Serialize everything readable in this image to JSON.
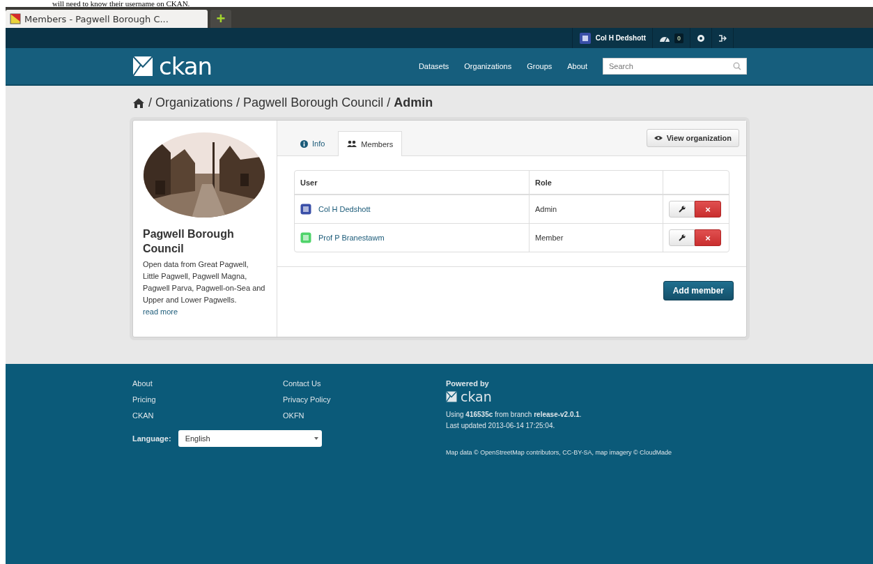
{
  "document_caption": "will need to know their username on CKAN.",
  "browser": {
    "tab_title": "Members - Pagwell Borough C...",
    "new_tab": "+"
  },
  "account_bar": {
    "user": "Col H Dedshott",
    "color": "#3a4fa8",
    "dashboard_count": "0"
  },
  "masthead": {
    "logo": "ckan",
    "nav": [
      {
        "label": "Datasets"
      },
      {
        "label": "Organizations"
      },
      {
        "label": "Groups"
      },
      {
        "label": "About"
      }
    ],
    "search": {
      "placeholder": "Search"
    }
  },
  "breadcrumb": {
    "separator": "/",
    "items": [
      {
        "label": "Organizations",
        "current": false
      },
      {
        "label": "Pagwell Borough Council",
        "current": false
      },
      {
        "label": "Admin",
        "current": true
      }
    ]
  },
  "organization": {
    "name": "Pagwell Borough Council",
    "description": "Open data from Great Pagwell, Little Pagwell, Pagwell Magna, Pagwell Parva, Pagwell-on-Sea and Upper and Lower Pagwells.",
    "read_more": "read more"
  },
  "tabs": [
    {
      "label": "Info",
      "kind": "info",
      "selected": false
    },
    {
      "label": "Members",
      "kind": "users",
      "selected": true
    }
  ],
  "view_button": "View organization",
  "table": {
    "columns": [
      "User",
      "Role"
    ],
    "rows": [
      {
        "user": "Col H Dedshott",
        "color": "#3a4fa8",
        "role": "Admin",
        "delete": "×"
      },
      {
        "user": "Prof P Branestawm",
        "color": "#4fd36a",
        "role": "Member",
        "delete": "×"
      }
    ]
  },
  "add_button": "Add member",
  "footer": {
    "links_1": [
      "About",
      "Pricing",
      "CKAN"
    ],
    "links_2": [
      "Contact Us",
      "Privacy Policy",
      "OKFN"
    ],
    "language": {
      "label": "Language:",
      "value": "English"
    },
    "powered_by": "Powered by",
    "logo": "ckan",
    "version": "Using **416535c** from branch **release-v2.0.1**.",
    "updated": "Last updated 2013-06-14 17:25:04.",
    "map_credit": "Map data © OpenStreetMap contributors, CC-BY-SA, map imagery © CloudMade"
  }
}
